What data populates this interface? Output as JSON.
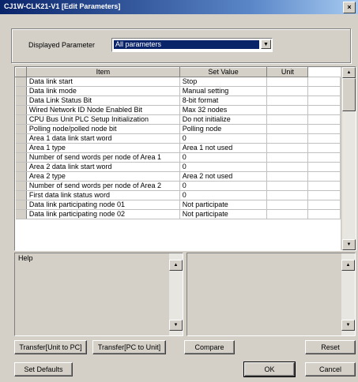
{
  "window": {
    "title": "CJ1W-CLK21-V1 [Edit Parameters]",
    "close_glyph": "×"
  },
  "display": {
    "label": "Displayed Parameter",
    "selected": "All parameters",
    "arrow": "▼"
  },
  "table": {
    "columns": [
      "Item",
      "Set Value",
      "Unit"
    ],
    "rows": [
      {
        "item": "Data link start",
        "value": "Stop",
        "unit": ""
      },
      {
        "item": "Data link mode",
        "value": "Manual setting",
        "unit": ""
      },
      {
        "item": "Data Link Status Bit",
        "value": "8-bit format",
        "unit": ""
      },
      {
        "item": "Wired Network ID Node Enabled Bit",
        "value": "Max 32 nodes",
        "unit": ""
      },
      {
        "item": "CPU Bus Unit PLC Setup Initialization",
        "value": "Do not initialize",
        "unit": ""
      },
      {
        "item": "Polling node/polled node bit",
        "value": "Polling node",
        "unit": ""
      },
      {
        "item": "Area 1 data link start word",
        "value": "0",
        "unit": ""
      },
      {
        "item": "Area 1 type",
        "value": "Area 1 not used",
        "unit": ""
      },
      {
        "item": "Number of send words per node of Area 1",
        "value": "0",
        "unit": ""
      },
      {
        "item": "Area 2 data link start word",
        "value": "0",
        "unit": ""
      },
      {
        "item": "Area 2 type",
        "value": "Area 2 not used",
        "unit": ""
      },
      {
        "item": "Number of send words per node of Area 2",
        "value": "0",
        "unit": ""
      },
      {
        "item": "First data link status word",
        "value": "0",
        "unit": ""
      },
      {
        "item": "Data link participating node 01",
        "value": "Not participate",
        "unit": ""
      },
      {
        "item": "Data link participating node 02",
        "value": "Not participate",
        "unit": ""
      }
    ]
  },
  "help": {
    "label": "Help"
  },
  "scroll": {
    "up": "▲",
    "down": "▼"
  },
  "buttons": {
    "transfer_to_pc": "Transfer[Unit to PC]",
    "transfer_to_unit": "Transfer[PC to Unit]",
    "compare": "Compare",
    "reset": "Reset",
    "set_defaults": "Set Defaults",
    "ok": "OK",
    "cancel": "Cancel"
  }
}
